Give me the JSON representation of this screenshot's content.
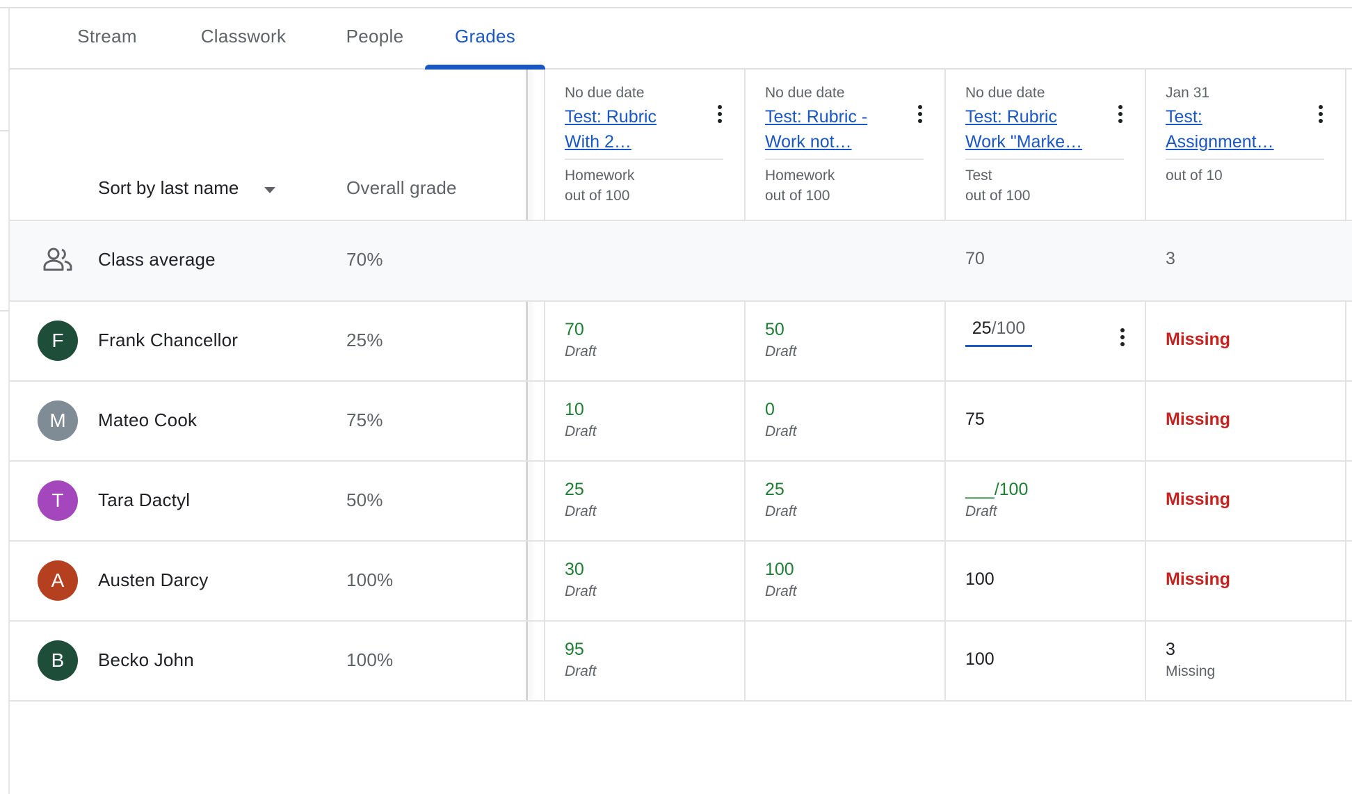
{
  "tabs": [
    {
      "label": "Stream"
    },
    {
      "label": "Classwork"
    },
    {
      "label": "People"
    },
    {
      "label": "Grades"
    }
  ],
  "sort": {
    "label": "Sort by last name"
  },
  "overall_header": "Overall grade",
  "assignments": [
    {
      "due": "No due date",
      "title_line1": "Test: Rubric",
      "title_line2": "With 2…",
      "category": "Homework",
      "points": "out of 100"
    },
    {
      "due": "No due date",
      "title_line1": "Test: Rubric -",
      "title_line2": "Work not…",
      "category": "Homework",
      "points": "out of 100"
    },
    {
      "due": "No due date",
      "title_line1": "Test: Rubric",
      "title_line2": "Work \"Marke…",
      "category": "Test",
      "points": "out of 100"
    },
    {
      "due": "Jan 31",
      "title_line1": "Test:",
      "title_line2": "Assignment…",
      "category": "",
      "points": "out of 10"
    }
  ],
  "class_average": {
    "label": "Class average",
    "overall": "70%",
    "values": [
      "",
      "",
      "70",
      "3"
    ]
  },
  "students": [
    {
      "initial": "F",
      "avatar_color": "#1e4d3a",
      "name": "Frank Chancellor",
      "overall": "25%",
      "a1": {
        "value": "70",
        "status": "Draft"
      },
      "a2": {
        "value": "50",
        "status": "Draft"
      },
      "a3": {
        "value": "25",
        "out_of": "/100"
      },
      "a4": {
        "value": "Missing"
      }
    },
    {
      "initial": "M",
      "avatar_color": "#7f8c96",
      "name": "Mateo Cook",
      "overall": "75%",
      "a1": {
        "value": "10",
        "status": "Draft"
      },
      "a2": {
        "value": "0",
        "status": "Draft"
      },
      "a3": {
        "value": "75"
      },
      "a4": {
        "value": "Missing"
      }
    },
    {
      "initial": "T",
      "avatar_color": "#a447bd",
      "name": "Tara Dactyl",
      "overall": "50%",
      "a1": {
        "value": "25",
        "status": "Draft"
      },
      "a2": {
        "value": "25",
        "status": "Draft"
      },
      "a3": {
        "value": "___/100",
        "status": "Draft"
      },
      "a4": {
        "value": "Missing"
      }
    },
    {
      "initial": "A",
      "avatar_color": "#b5401f",
      "name": "Austen Darcy",
      "overall": "100%",
      "a1": {
        "value": "30",
        "status": "Draft"
      },
      "a2": {
        "value": "100",
        "status": "Draft"
      },
      "a3": {
        "value": "100"
      },
      "a4": {
        "value": "Missing"
      }
    },
    {
      "initial": "B",
      "avatar_color": "#1e4d3a",
      "name": "Becko John",
      "overall": "100%",
      "a1": {
        "value": "95",
        "status": "Draft"
      },
      "a2": {
        "value": ""
      },
      "a3": {
        "value": "100"
      },
      "a4": {
        "value": "3",
        "status": "Missing"
      }
    }
  ],
  "colors": {
    "accent": "#1a56c4",
    "graded_green": "#1e7e34",
    "missing_red": "#c5221f"
  }
}
